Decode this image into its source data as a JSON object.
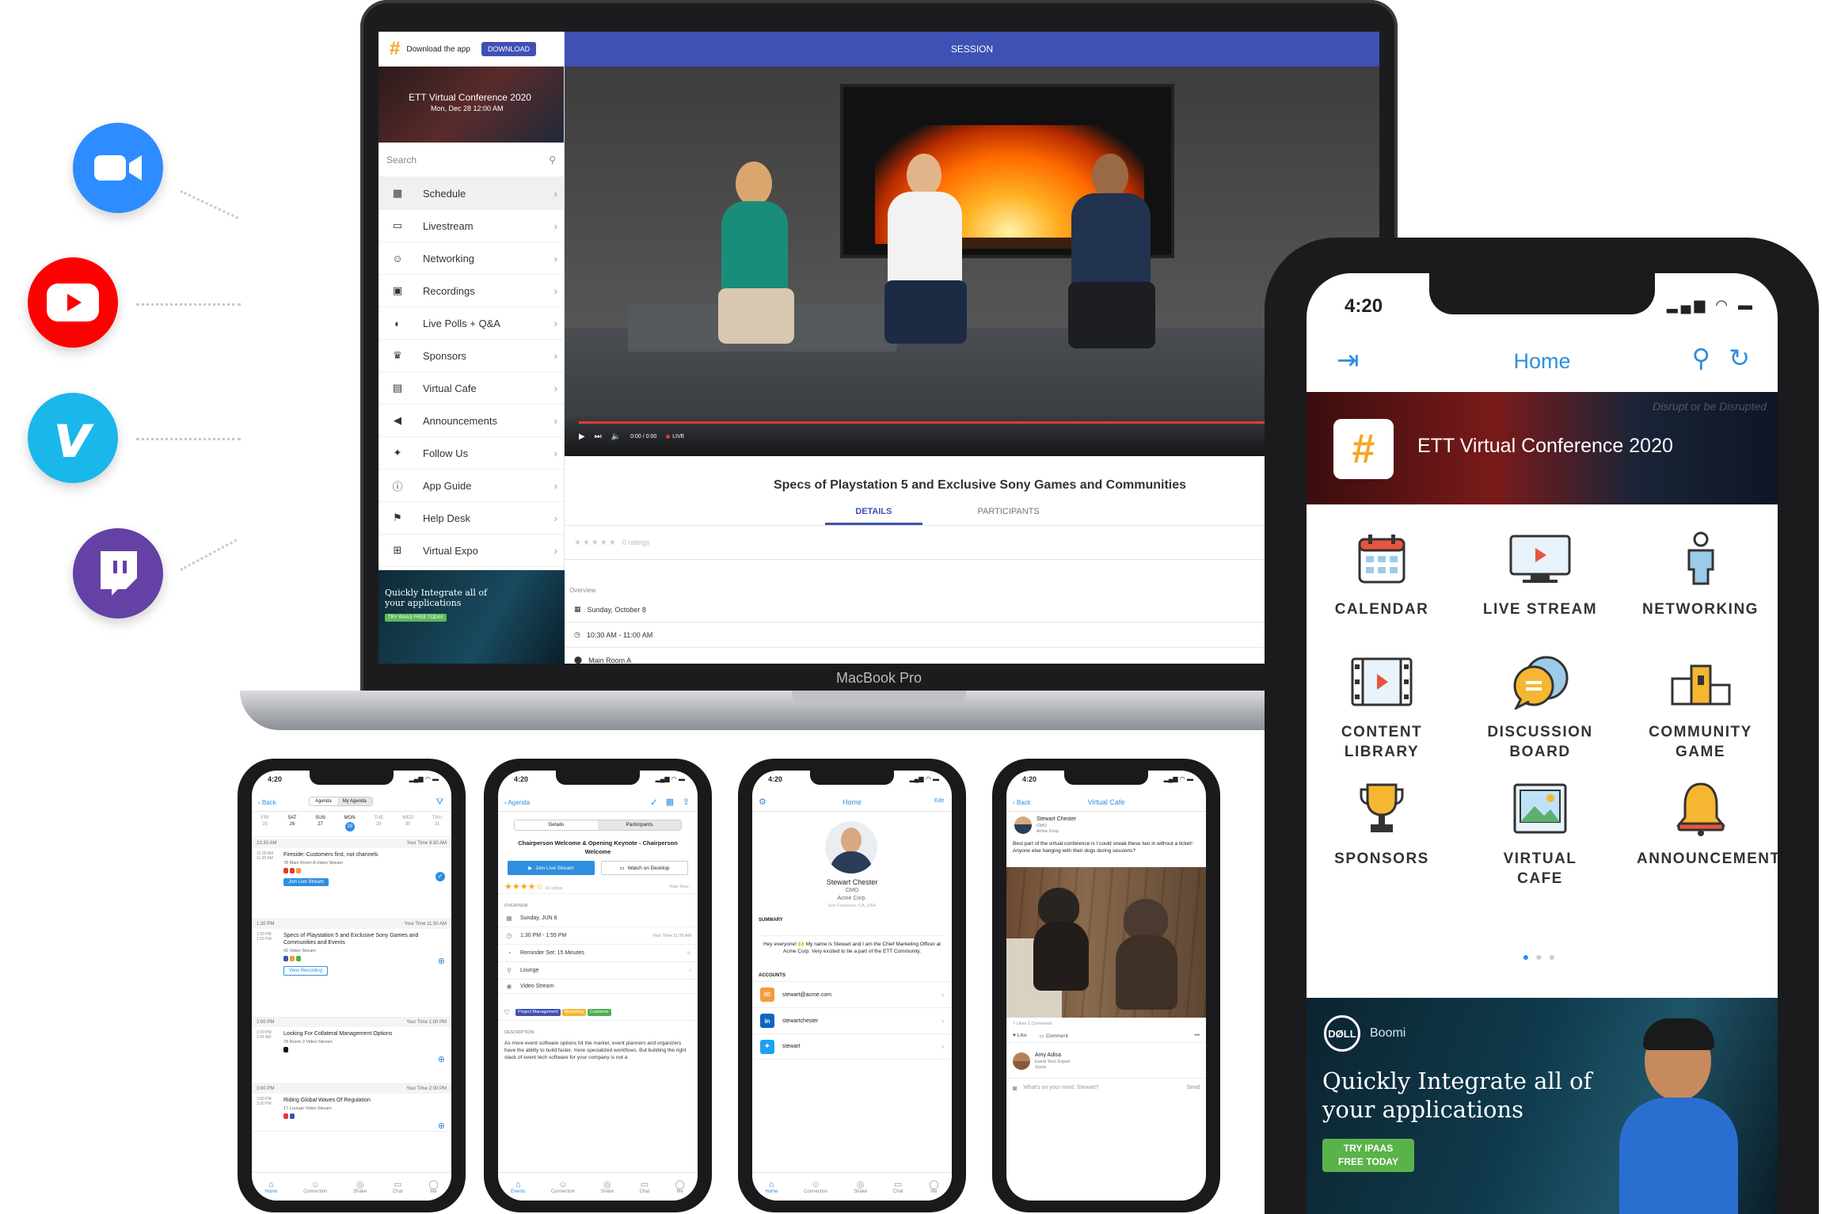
{
  "laptop": {
    "brand_label": "MacBook Pro",
    "header": {
      "download_text": "Download the app",
      "download_button": "DOWNLOAD",
      "session_label": "SESSION"
    },
    "event": {
      "title": "ETT Virtual Conference 2020",
      "date": "Mon, Dec 28 12:00 AM"
    },
    "search_placeholder": "Search",
    "sidebar_items": [
      {
        "label": "Schedule",
        "icon": "calendar-icon"
      },
      {
        "label": "Livestream",
        "icon": "tv-icon"
      },
      {
        "label": "Networking",
        "icon": "people-icon"
      },
      {
        "label": "Recordings",
        "icon": "film-icon"
      },
      {
        "label": "Live Polls + Q&A",
        "icon": "chat-icon"
      },
      {
        "label": "Sponsors",
        "icon": "trophy-icon"
      },
      {
        "label": "Virtual Cafe",
        "icon": "image-icon"
      },
      {
        "label": "Announcements",
        "icon": "megaphone-icon"
      },
      {
        "label": "Follow Us",
        "icon": "twitter-icon"
      },
      {
        "label": "App Guide",
        "icon": "info-icon"
      },
      {
        "label": "Help Desk",
        "icon": "helpdesk-icon"
      },
      {
        "label": "Virtual Expo",
        "icon": "expo-icon"
      }
    ],
    "ad": {
      "line1": "Quickly Integrate all of",
      "line2": "your applications",
      "cta": "TRY IPAAS FREE TODAY"
    },
    "video": {
      "time": "0:00 / 0:00",
      "live": "LIVE"
    },
    "session_title": "Specs of Playstation 5 and Exclusive Sony Games and Communities",
    "tabs": [
      "DETAILS",
      "PARTICIPANTS"
    ],
    "ratings_text": "0 ratings",
    "overview_label": "Overview",
    "details": {
      "date": "Sunday, October 8",
      "time": "10:30 AM - 11:00 AM",
      "room": "Main Room A"
    }
  },
  "phone_main": {
    "time": "4:20",
    "nav_title": "Home",
    "banner_title": "ETT Virtual Conference 2020",
    "banner_bg_text": "Disrupt or be Disrupted",
    "grid": [
      {
        "label": "CALENDAR",
        "icon": "calendar-icon"
      },
      {
        "label": "LIVE STREAM",
        "icon": "monitor-play-icon"
      },
      {
        "label": "NETWORKING",
        "icon": "person-network-icon"
      },
      {
        "label": "CONTENT LIBRARY",
        "icon": "film-strip-icon"
      },
      {
        "label": "DISCUSSION BOARD",
        "icon": "chat-bubbles-icon"
      },
      {
        "label": "COMMUNITY GAME",
        "icon": "podium-icon"
      },
      {
        "label": "SPONSORS",
        "icon": "trophy-icon"
      },
      {
        "label": "VIRTUAL CAFE",
        "icon": "picture-icon"
      },
      {
        "label": "ANNOUNCEMENTS",
        "icon": "bell-icon"
      }
    ],
    "ad": {
      "brand": "Boomi",
      "line1": "Quickly Integrate all of",
      "line2": "your applications",
      "cta1": "TRY IPAAS",
      "cta2": "FREE TODAY"
    }
  },
  "phone_agenda": {
    "time": "4:20",
    "back": "Back",
    "seg": [
      "Agenda",
      "My Agenda"
    ],
    "days": [
      {
        "d": "FRI",
        "n": "25"
      },
      {
        "d": "SAT",
        "n": "26"
      },
      {
        "d": "SUN",
        "n": "27"
      },
      {
        "d": "MON",
        "n": "28"
      },
      {
        "d": "TUE",
        "n": "29"
      },
      {
        "d": "WED",
        "n": "30"
      },
      {
        "d": "THU",
        "n": "31"
      }
    ],
    "blocks": [
      {
        "time": "10:30 AM",
        "your": "Your Time 8:30 AM",
        "start": "10:30 AM",
        "end": "11:00 AM",
        "title": "Fireside: Customers first, not channels",
        "meta": "78   Main Room A   Video Stream",
        "btn": "Join Live Stream"
      },
      {
        "time": "1:30 PM",
        "your": "Your Time 11:30 AM",
        "start": "1:30 PM",
        "end": "1:55 PM",
        "title": "Specs of Playstation 5 and Exclusive Sony Games and Communities and Events",
        "meta": "42   Video Stream",
        "btn": "View Recording"
      },
      {
        "time": "2:00 PM",
        "your": "Your Time 1:00 PM",
        "start": "2:00 PM",
        "end": "2:45 AM",
        "title": "Looking For Collateral Management Options",
        "meta": "78   Room 2   Video Stream",
        "btn": ""
      },
      {
        "time": "3:00 PM",
        "your": "Your Time 2:00 PM",
        "start": "3:00 PM",
        "end": "3:30 PM",
        "title": "Riding Global Waves Of Regulation",
        "meta": "17   Lounge   Video Stream",
        "btn": ""
      }
    ],
    "tabbar": [
      "Home",
      "Connection",
      "Shake",
      "Chat",
      "Me"
    ]
  },
  "phone_session": {
    "time": "4:20",
    "back": "Agenda",
    "seg": [
      "Details",
      "Participants"
    ],
    "title": "Chairperson Welcome & Opening Keynote - Chairperson Welcome",
    "join": "Join Live Stream",
    "watch": "Watch on Desktop",
    "ratings": "16 ratings",
    "rate_now": "Rate Now",
    "overview": "OVERVIEW",
    "rows": [
      {
        "icon": "calendar-icon",
        "text": "Sunday, JUN 8",
        "right": ""
      },
      {
        "icon": "clock-icon",
        "text": "1:30 PM - 1:55 PM",
        "right": "Your Time 11:30 AM"
      },
      {
        "icon": "bell-icon",
        "text": "Reminder Set: 15 Minutes",
        "right": ""
      },
      {
        "icon": "pin-icon",
        "text": "Lounge",
        "right": ""
      },
      {
        "icon": "stream-icon",
        "text": "Video Stream",
        "right": ""
      }
    ],
    "tags": [
      "Project Management",
      "Marketing",
      "Customer"
    ],
    "description_label": "DESCRIPTION",
    "description": "As more event software options hit the market, event planners and organizers have the ability to build faster, more specialized workflows. But building the right stack of event tech software for your company is not a",
    "tabbar": [
      "Events",
      "Connection",
      "Shake",
      "Chat",
      "Me"
    ]
  },
  "phone_profile": {
    "time": "4:20",
    "title": "Home",
    "edit": "Edit",
    "name": "Stewart Chester",
    "role": "CMO",
    "company": "Acme Corp.",
    "location": "San Francisco, CA, USA",
    "summary_label": "SUMMARY",
    "summary": "Hey everyone! 🙌 My name is Stewart and I am the Chief Marketing Officer at Acme Corp. Very excited to be a part of the ETT Community.",
    "accounts_label": "ACCOUNTS",
    "accounts": [
      {
        "type": "mail",
        "value": "stewart@acme.com"
      },
      {
        "type": "linkedin",
        "value": "stewartchester"
      },
      {
        "type": "twitter",
        "value": "stewart"
      }
    ],
    "tabbar": [
      "Home",
      "Connection",
      "Shake",
      "Chat",
      "Me"
    ]
  },
  "phone_cafe": {
    "time": "4:20",
    "back": "Back",
    "title": "Virtual Cafe",
    "author": "Stewart Chester",
    "role": "CMO",
    "company": "Acme Corp.",
    "post": "Best part of the virtual conference is I could sneak these two in without a ticket! Anyone else hanging with their dogs during sessions?",
    "stats": "7 Likes  1 Comments",
    "like": "Like",
    "comment": "Comment",
    "commenter": "Amy Adisa",
    "commenter_role": "Event Tech Expert",
    "commenter_company": "Socio",
    "compose_placeholder": "What's on your mind, Stewart?",
    "send": "Send"
  },
  "social": [
    {
      "name": "zoom",
      "color": "#2D8CFF"
    },
    {
      "name": "youtube",
      "color": "#FF0000"
    },
    {
      "name": "vimeo",
      "color": "#1AB7EA"
    },
    {
      "name": "twitch",
      "color": "#6441A5"
    }
  ],
  "colors": {
    "accent": "#2f8ee0",
    "session_header": "#3f51b5",
    "live_red": "#e53935"
  }
}
